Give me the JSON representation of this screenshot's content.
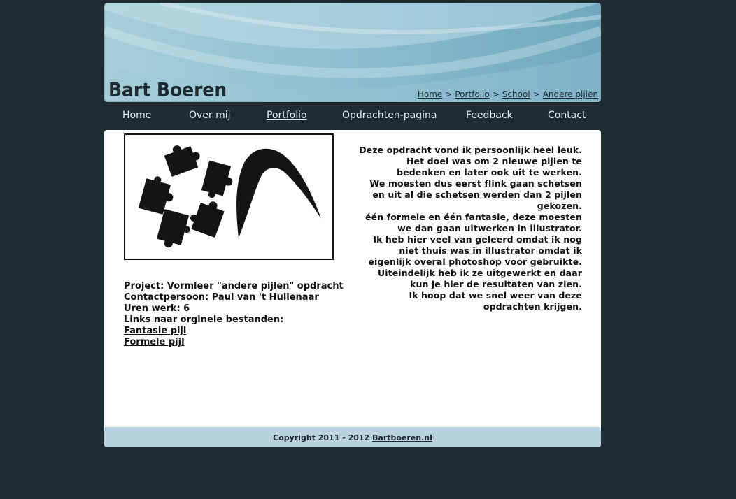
{
  "site": {
    "title": "Bart Boeren"
  },
  "breadcrumb": {
    "items": [
      "Home",
      "Portfolio",
      "School",
      "Andere pijlen"
    ],
    "separator": ">"
  },
  "nav": {
    "items": [
      {
        "label": "Home",
        "active": false
      },
      {
        "label": "Over mij",
        "active": false
      },
      {
        "label": "Portfolio",
        "active": true
      },
      {
        "label": "Opdrachten-pagina",
        "active": false
      },
      {
        "label": "Feedback",
        "active": false
      },
      {
        "label": "Contact",
        "active": false
      }
    ]
  },
  "project": {
    "name_line": "Project: Vormleer \"andere pijlen\" opdracht",
    "contact_line": "Contactpersoon: Paul van 't Hullenaar",
    "hours_line": "Uren werk: 6",
    "links_heading": "Links naar orginele bestanden:",
    "link_fantasie": "Fantasie pijl",
    "link_formele": "Formele pijl"
  },
  "description": {
    "paragraphs": [
      "Deze opdracht vond ik persoonlijk heel leuk. Het doel was om 2 nieuwe pijlen te bedenken en later ook uit te werken.",
      "We moesten dus eerst flink gaan schetsen en uit al die schetsen werden dan 2 pijlen gekozen.",
      "één formele en één fantasie, deze moesten we dan gaan uitwerken in illustrator.",
      "Ik heb hier veel van geleerd omdat ik nog niet thuis was in illustrator omdat ik eigenlijk overal photoshop voor gebruikte.",
      "Uiteindelijk heb ik ze uitgewerkt en daar kun je hier de resultaten van zien.",
      "Ik hoop dat we snel weer van deze opdrachten krijgen."
    ]
  },
  "footer": {
    "text": "Copyright 2011 - 2012",
    "link": "Bartboeren.nl"
  },
  "colors": {
    "background": "#212b32",
    "header_light": "#a9cfda",
    "header_dark": "#6fa8bf",
    "footer_bar": "#b8d3de",
    "text_dark": "#1f2a30"
  }
}
